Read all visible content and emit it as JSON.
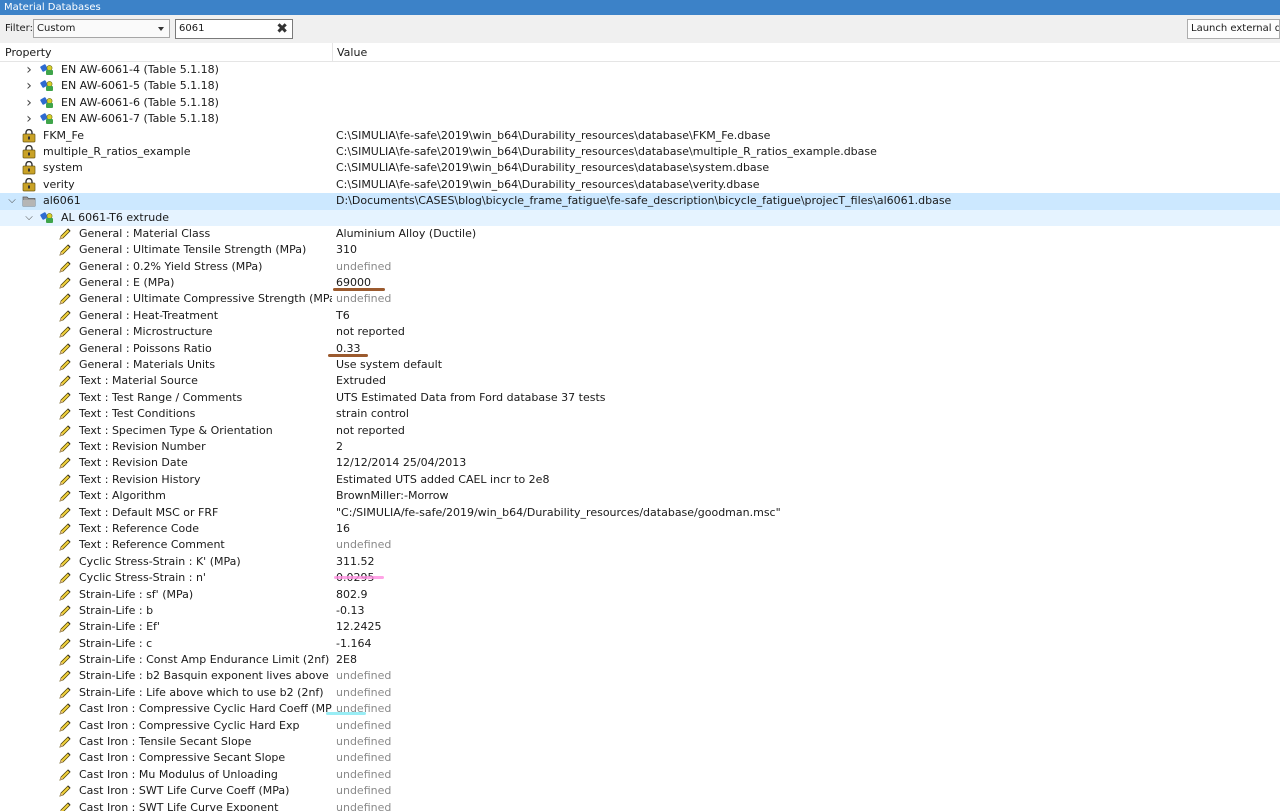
{
  "window": {
    "title": "Material Databases"
  },
  "toolbar": {
    "filter_label": "Filter:",
    "filter_value": "Custom",
    "search_value": "6061",
    "launch_label": "Launch external data"
  },
  "columns": {
    "property": "Property",
    "value": "Value"
  },
  "colors": {
    "selected_row": "#cce8ff",
    "hover_row": "#e5f3ff",
    "titlebar": "#3c82c8"
  },
  "rows": [
    {
      "label": "EN AW-6061-4 (Table 5.1.18)",
      "value": "",
      "level": 1,
      "icon": "material-icon",
      "chevron": "chevron-right"
    },
    {
      "label": "EN AW-6061-5 (Table 5.1.18)",
      "value": "",
      "level": 1,
      "icon": "material-icon",
      "chevron": "chevron-right"
    },
    {
      "label": "EN AW-6061-6 (Table 5.1.18)",
      "value": "",
      "level": 1,
      "icon": "material-icon",
      "chevron": "chevron-right"
    },
    {
      "label": "EN AW-6061-7 (Table 5.1.18)",
      "value": "",
      "level": 1,
      "icon": "material-icon",
      "chevron": "chevron-right"
    },
    {
      "label": "FKM_Fe",
      "value": "C:\\SIMULIA\\fe-safe\\2019\\win_b64\\Durability_resources\\database\\FKM_Fe.dbase",
      "level": 0,
      "icon": "locked-database-icon"
    },
    {
      "label": "multiple_R_ratios_example",
      "value": "C:\\SIMULIA\\fe-safe\\2019\\win_b64\\Durability_resources\\database\\multiple_R_ratios_example.dbase",
      "level": 0,
      "icon": "locked-database-icon"
    },
    {
      "label": "system",
      "value": "C:\\SIMULIA\\fe-safe\\2019\\win_b64\\Durability_resources\\database\\system.dbase",
      "level": 0,
      "icon": "locked-database-icon"
    },
    {
      "label": "verity",
      "value": "C:\\SIMULIA\\fe-safe\\2019\\win_b64\\Durability_resources\\database\\verity.dbase",
      "level": 0,
      "icon": "locked-database-icon"
    },
    {
      "label": "al6061",
      "value": "D:\\Documents\\CASES\\blog\\bicycle_frame_fatigue\\fe-safe_description\\bicycle_fatigue\\projecT_files\\al6061.dbase",
      "level": 0,
      "icon": "folder-icon",
      "chevron": "chevron-down",
      "selected": true
    },
    {
      "label": "AL 6061-T6 extrude",
      "value": "",
      "level": 1,
      "icon": "material-icon",
      "chevron": "chevron-down",
      "hover": true
    },
    {
      "label": "General : Material Class",
      "value": "Aluminium Alloy (Ductile)",
      "level": 2,
      "icon": "pencil-icon"
    },
    {
      "label": "General : Ultimate Tensile Strength (MPa)",
      "value": "310",
      "level": 2,
      "icon": "pencil-icon"
    },
    {
      "label": "General : 0.2% Yield Stress (MPa)",
      "value": "undefined",
      "level": 2,
      "icon": "pencil-icon"
    },
    {
      "label": "General : E (MPa)",
      "value": "69000",
      "level": 2,
      "icon": "pencil-icon"
    },
    {
      "label": "General : Ultimate Compressive Strength (MPa)",
      "value": "undefined",
      "level": 2,
      "icon": "pencil-icon"
    },
    {
      "label": "General : Heat-Treatment",
      "value": "T6",
      "level": 2,
      "icon": "pencil-icon"
    },
    {
      "label": "General : Microstructure",
      "value": "not reported",
      "level": 2,
      "icon": "pencil-icon"
    },
    {
      "label": "General : Poissons Ratio",
      "value": "0.33",
      "level": 2,
      "icon": "pencil-icon"
    },
    {
      "label": "General : Materials Units",
      "value": "Use system default",
      "level": 2,
      "icon": "pencil-icon"
    },
    {
      "label": "Text : Material Source",
      "value": "Extruded",
      "level": 2,
      "icon": "pencil-icon"
    },
    {
      "label": "Text : Test Range / Comments",
      "value": "UTS Estimated Data from Ford database 37 tests",
      "level": 2,
      "icon": "pencil-icon"
    },
    {
      "label": "Text : Test Conditions",
      "value": "strain control",
      "level": 2,
      "icon": "pencil-icon"
    },
    {
      "label": "Text : Specimen Type & Orientation",
      "value": "not reported",
      "level": 2,
      "icon": "pencil-icon"
    },
    {
      "label": "Text : Revision Number",
      "value": "2",
      "level": 2,
      "icon": "pencil-icon"
    },
    {
      "label": "Text : Revision Date",
      "value": "12/12/2014 25/04/2013",
      "level": 2,
      "icon": "pencil-icon"
    },
    {
      "label": "Text : Revision History",
      "value": "Estimated UTS added CAEL incr to 2e8",
      "level": 2,
      "icon": "pencil-icon"
    },
    {
      "label": "Text : Algorithm",
      "value": "BrownMiller:-Morrow",
      "level": 2,
      "icon": "pencil-icon"
    },
    {
      "label": "Text : Default MSC or FRF",
      "value": "\"C:/SIMULIA/fe-safe/2019/win_b64/Durability_resources/database/goodman.msc\"",
      "level": 2,
      "icon": "pencil-icon"
    },
    {
      "label": "Text : Reference Code",
      "value": "16",
      "level": 2,
      "icon": "pencil-icon"
    },
    {
      "label": "Text : Reference Comment",
      "value": "undefined",
      "level": 2,
      "icon": "pencil-icon"
    },
    {
      "label": "Cyclic Stress-Strain : K' (MPa)",
      "value": "311.52",
      "level": 2,
      "icon": "pencil-icon"
    },
    {
      "label": "Cyclic Stress-Strain : n'",
      "value": "0.0295",
      "level": 2,
      "icon": "pencil-icon"
    },
    {
      "label": "Strain-Life : sf' (MPa)",
      "value": "802.9",
      "level": 2,
      "icon": "pencil-icon"
    },
    {
      "label": "Strain-Life : b",
      "value": "-0.13",
      "level": 2,
      "icon": "pencil-icon"
    },
    {
      "label": "Strain-Life : Ef'",
      "value": "12.2425",
      "level": 2,
      "icon": "pencil-icon"
    },
    {
      "label": "Strain-Life : c",
      "value": "-1.164",
      "level": 2,
      "icon": "pencil-icon"
    },
    {
      "label": "Strain-Life : Const Amp Endurance Limit (2nf)",
      "value": "2E8",
      "level": 2,
      "icon": "pencil-icon"
    },
    {
      "label": "Strain-Life : b2 Basquin exponent lives above knee",
      "value": "undefined",
      "level": 2,
      "icon": "pencil-icon"
    },
    {
      "label": "Strain-Life : Life above which to use b2 (2nf)",
      "value": "undefined",
      "level": 2,
      "icon": "pencil-icon"
    },
    {
      "label": "Cast Iron : Compressive Cyclic Hard Coeff (MPa)",
      "value": "undefined",
      "level": 2,
      "icon": "pencil-icon"
    },
    {
      "label": "Cast Iron : Compressive Cyclic Hard Exp",
      "value": "undefined",
      "level": 2,
      "icon": "pencil-icon"
    },
    {
      "label": "Cast Iron : Tensile Secant Slope",
      "value": "undefined",
      "level": 2,
      "icon": "pencil-icon"
    },
    {
      "label": "Cast Iron : Compressive Secant Slope",
      "value": "undefined",
      "level": 2,
      "icon": "pencil-icon"
    },
    {
      "label": "Cast Iron : Mu Modulus of Unloading",
      "value": "undefined",
      "level": 2,
      "icon": "pencil-icon"
    },
    {
      "label": "Cast Iron : SWT Life Curve Coeff (MPa)",
      "value": "undefined",
      "level": 2,
      "icon": "pencil-icon"
    },
    {
      "label": "Cast Iron : SWT Life Curve Exponent",
      "value": "undefined",
      "level": 2,
      "icon": "pencil-icon"
    }
  ]
}
